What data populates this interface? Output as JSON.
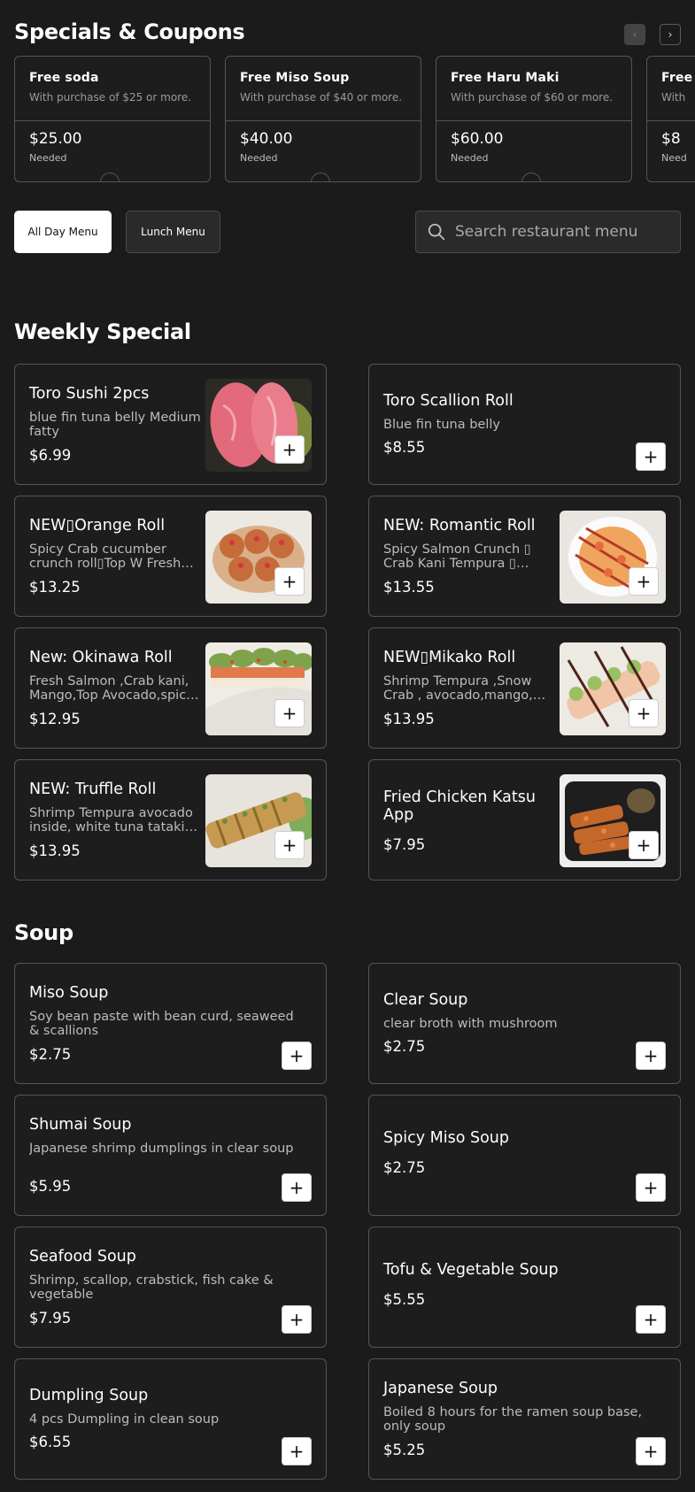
{
  "coupons_section": {
    "title": "Specials & Coupons",
    "coupons": [
      {
        "title": "Free soda",
        "subtitle": "With purchase of $25 or more.",
        "amount": "$25.00",
        "needed_label": "Needed"
      },
      {
        "title": "Free Miso Soup",
        "subtitle": "With purchase of $40 or more.",
        "amount": "$40.00",
        "needed_label": "Needed"
      },
      {
        "title": "Free Haru Maki",
        "subtitle": "With purchase of $60 or more.",
        "amount": "$60.00",
        "needed_label": "Needed"
      },
      {
        "title": "Free ",
        "subtitle": "With ",
        "amount": "$8",
        "needed_label": "Need"
      }
    ]
  },
  "menu_tabs": [
    {
      "label": "All Day Menu",
      "active": true
    },
    {
      "label": "Lunch Menu",
      "active": false
    }
  ],
  "search": {
    "placeholder": "Search restaurant menu"
  },
  "sections": [
    {
      "title": "Weekly Special",
      "items": [
        {
          "name": "Toro Sushi 2pcs",
          "description": "blue fin tuna belly Medium fatty",
          "price": "$6.99",
          "image": "toro-sushi"
        },
        {
          "name": "Toro Scallion Roll",
          "description": "Blue fin tuna belly",
          "price": "$8.55",
          "image": null
        },
        {
          "name": "NEW▯Orange Roll",
          "description": "Spicy Crab cucumber crunch roll▯Top W Fresh Salmon & special sauce",
          "price": "$13.25",
          "image": "orange-roll"
        },
        {
          "name": "NEW: Romantic Roll",
          "description": "Spicy Salmon Crunch ▯ Crab Kani Tempura ▯ Avocado",
          "price": "$13.55",
          "image": "romantic-roll"
        },
        {
          "name": "New: Okinawa Roll",
          "description": "Fresh Salmon ,Crab kani, Mango,Top Avocado,spicy mayo",
          "price": "$12.95",
          "image": "okinawa-roll"
        },
        {
          "name": "NEW▯Mikako Roll",
          "description": "Shrimp Tempura ,Snow Crab , avocado,mango, eel sauce",
          "price": "$13.95",
          "image": "mikako-roll"
        },
        {
          "name": "NEW: Truffle Roll",
          "description": "Shrimp Tempura avocado inside, white tuna tataki on top",
          "price": "$13.95",
          "image": "truffle-roll"
        },
        {
          "name": "Fried Chicken Katsu App",
          "description": "",
          "price": "$7.95",
          "image": "katsu"
        }
      ]
    },
    {
      "title": "Soup",
      "items": [
        {
          "name": "Miso Soup",
          "description": "Soy bean paste with bean curd, seaweed & scallions",
          "price": "$2.75",
          "image": null
        },
        {
          "name": "Clear Soup",
          "description": "clear broth with mushroom",
          "price": "$2.75",
          "image": null
        },
        {
          "name": "Shumai Soup",
          "description": "Japanese shrimp dumplings in clear soup",
          "price": "$5.95",
          "image": null
        },
        {
          "name": "Spicy Miso Soup",
          "description": "",
          "price": "$2.75",
          "image": null
        },
        {
          "name": "Seafood Soup",
          "description": "Shrimp, scallop, crabstick, fish cake & vegetable",
          "price": "$7.95",
          "image": null
        },
        {
          "name": "Tofu & Vegetable Soup",
          "description": "",
          "price": "$5.55",
          "image": null
        },
        {
          "name": "Dumpling Soup",
          "description": "4 pcs Dumpling in clean soup",
          "price": "$6.55",
          "image": null
        },
        {
          "name": "Japanese Soup",
          "description": "Boiled 8 hours for the ramen soup base, only soup",
          "price": "$5.25",
          "image": null
        }
      ]
    }
  ],
  "icons": {
    "prev": "chevron-left-icon",
    "next": "chevron-right-icon",
    "search": "search-icon",
    "add": "plus-icon"
  },
  "colors": {
    "background": "#1c1b1c",
    "card_border": "#555555",
    "active_tab": "#ffffff"
  }
}
